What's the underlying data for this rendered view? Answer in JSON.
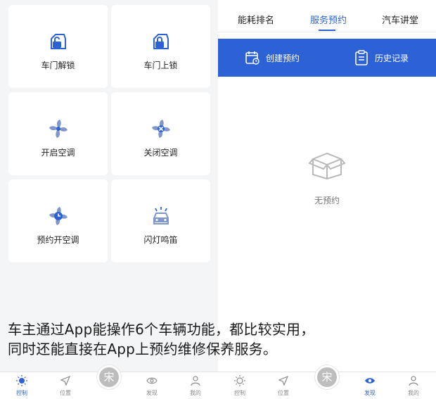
{
  "left_panel": {
    "tiles": [
      {
        "label": "车门解锁",
        "icon": "car-door-unlock-icon"
      },
      {
        "label": "车门上锁",
        "icon": "car-door-lock-icon"
      },
      {
        "label": "开启空调",
        "icon": "fan-icon"
      },
      {
        "label": "关闭空调",
        "icon": "fan-off-icon"
      },
      {
        "label": "预约开空调",
        "icon": "fan-clock-icon"
      },
      {
        "label": "闪灯鸣笛",
        "icon": "car-horn-icon"
      }
    ]
  },
  "right_panel": {
    "tabs": [
      {
        "label": "能耗排名"
      },
      {
        "label": "服务预约",
        "active": true
      },
      {
        "label": "汽车讲堂"
      }
    ],
    "actions": [
      {
        "label": "创建预约",
        "icon": "calendar-icon"
      },
      {
        "label": "历史记录",
        "icon": "clipboard-icon"
      }
    ],
    "empty_state": {
      "text": "无预约",
      "icon": "empty-box-icon"
    }
  },
  "caption": {
    "line1": "车主通过App能操作6个车辆功能，都比较实用，",
    "line2": "同时还能直接在App上预约维修保养服务。"
  },
  "nav_left": {
    "items": [
      "控制",
      "位置",
      "发现",
      "我的"
    ],
    "active": "控制",
    "center_glyph": "宋"
  },
  "nav_right": {
    "items": [
      "控制",
      "位置",
      "发现",
      "我的"
    ],
    "active": "发现",
    "center_glyph": "宋"
  },
  "colors": {
    "accent": "#2d62d6",
    "panel_bg": "#f4f5f7",
    "muted": "#8a8a8a"
  }
}
